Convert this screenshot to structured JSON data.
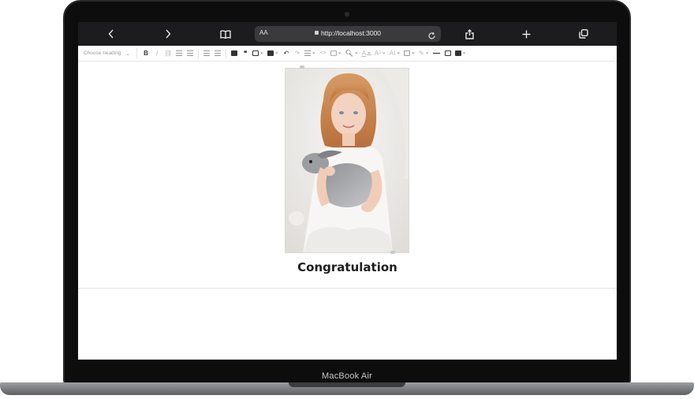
{
  "device": {
    "label": "MacBook Air"
  },
  "browser": {
    "url_text_size": "AA",
    "url": "http://localhost:3000"
  },
  "toolbar": {
    "heading_placeholder": "Choose heading",
    "buttons": [
      {
        "name": "bold-button",
        "label": "B"
      },
      {
        "name": "italic-button",
        "label": "I"
      },
      {
        "name": "link-button",
        "label": "⛓"
      },
      {
        "name": "bulleted-list-button",
        "label": "≡"
      },
      {
        "name": "numbered-list-button",
        "label": "≡"
      },
      {
        "name": "outdent-button",
        "label": "⇤"
      },
      {
        "name": "indent-button",
        "label": "⇥"
      }
    ],
    "code_label": "<>",
    "font_color_label": "A",
    "font_size_label": "A²",
    "font_family_label": "AI"
  },
  "content": {
    "caption": "Congratulation",
    "image_alt_icon": "photo-of-girl-holding-rabbit"
  },
  "colors": {
    "safari_bar": "#1c1c1e",
    "url_field": "#3a3a3c",
    "bezel": "#0d0d0d"
  }
}
